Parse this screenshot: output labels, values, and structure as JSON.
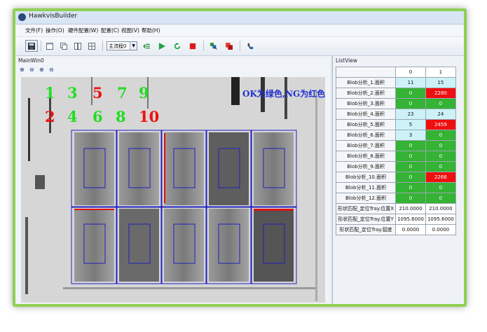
{
  "window": {
    "title": "HawkvisBuilder"
  },
  "menu": [
    "文件(F)",
    "操作(O)",
    "硬件配置(W)",
    "配置(C)",
    "视图(V)",
    "帮助(H)"
  ],
  "toolbar": {
    "flow_select": "主流程0"
  },
  "main_panel": {
    "title": "MainWin0"
  },
  "overlay": {
    "numbers_green": [
      "1",
      "3",
      "5",
      "7",
      "9"
    ],
    "numbers_red": [
      "2",
      "4",
      "6",
      "8",
      "10"
    ],
    "note": "OK为绿色,NG为红色"
  },
  "list_view": {
    "title": "ListView",
    "columns": [
      "",
      "0",
      "1"
    ],
    "rows": [
      {
        "label": "Blob分析_1.面积",
        "v0": "11",
        "c0": "cyan",
        "v1": "15",
        "c1": "cyan"
      },
      {
        "label": "Blob分析_2.面积",
        "v0": "0",
        "c0": "green",
        "v1": "2280",
        "c1": "red"
      },
      {
        "label": "Blob分析_3.面积",
        "v0": "0",
        "c0": "green",
        "v1": "0",
        "c1": "green"
      },
      {
        "label": "Blob分析_4.面积",
        "v0": "23",
        "c0": "cyan",
        "v1": "24",
        "c1": "cyan"
      },
      {
        "label": "Blob分析_5.面积",
        "v0": "5",
        "c0": "cyan",
        "v1": "2459",
        "c1": "red"
      },
      {
        "label": "Blob分析_6.面积",
        "v0": "3",
        "c0": "cyan",
        "v1": "0",
        "c1": "green"
      },
      {
        "label": "Blob分析_7.面积",
        "v0": "0",
        "c0": "green",
        "v1": "0",
        "c1": "green"
      },
      {
        "label": "Blob分析_8.面积",
        "v0": "0",
        "c0": "green",
        "v1": "0",
        "c1": "green"
      },
      {
        "label": "Blob分析_9.面积",
        "v0": "0",
        "c0": "green",
        "v1": "0",
        "c1": "green"
      },
      {
        "label": "Blob分析_10.面积",
        "v0": "0",
        "c0": "green",
        "v1": "2266",
        "c1": "red"
      },
      {
        "label": "Blob分析_11.面积",
        "v0": "0",
        "c0": "green",
        "v1": "0",
        "c1": "green"
      },
      {
        "label": "Blob分析_12.面积",
        "v0": "0",
        "c0": "green",
        "v1": "0",
        "c1": "green"
      },
      {
        "label": "形状匹配_定位Tray.位置X",
        "v0": "210.0000",
        "c0": "white",
        "v1": "210.0000",
        "c1": "white"
      },
      {
        "label": "形状匹配_定位Tray.位置Y",
        "v0": "1095.6000",
        "c0": "white",
        "v1": "1095.6000",
        "c1": "white"
      },
      {
        "label": "形状匹配_定位Tray.弧度",
        "v0": "0.0000",
        "c0": "white",
        "v1": "0.0000",
        "c1": "white"
      }
    ]
  },
  "colors": {
    "ok": "#34b334",
    "ng": "#ee1010",
    "info": "#ccf2f7",
    "frame": "#8fd053"
  }
}
